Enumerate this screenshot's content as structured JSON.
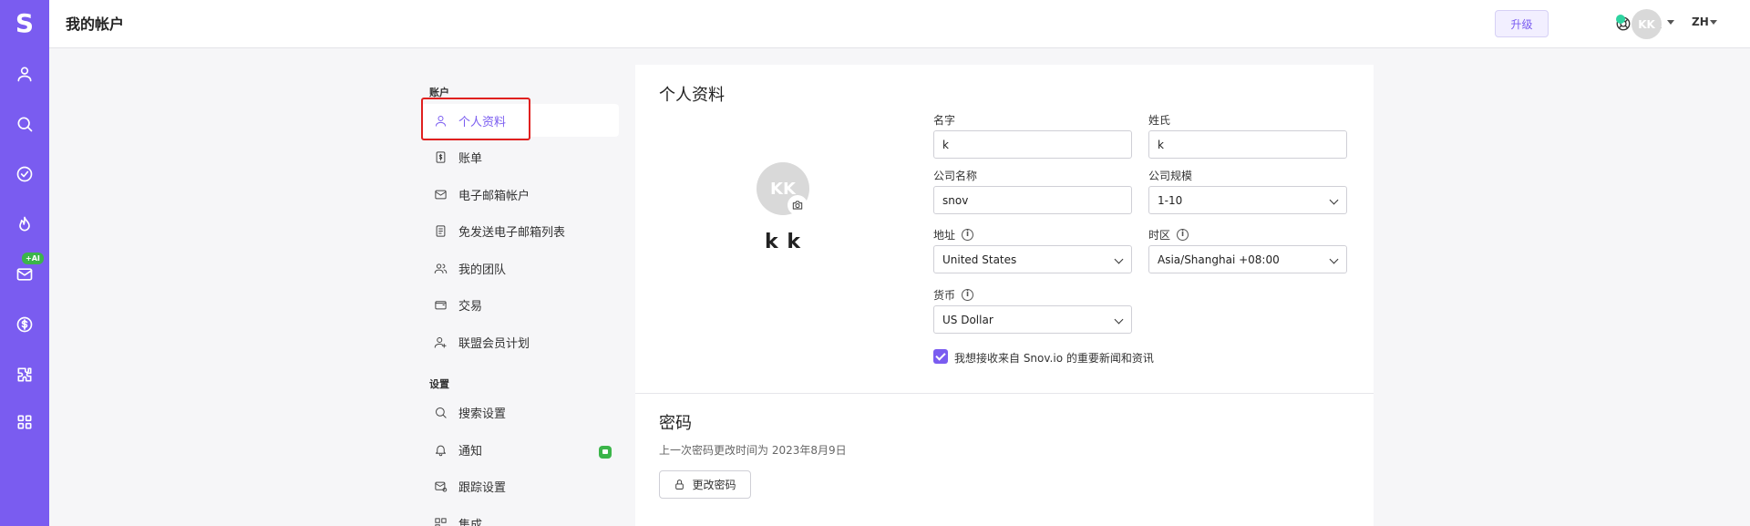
{
  "rail": {
    "logo": "S",
    "ai_badge": "+AI",
    "icons": [
      "user-icon",
      "search-icon",
      "check-circle-icon",
      "flame-icon",
      "mail-icon",
      "dollar-icon",
      "puzzle-icon",
      "apps-grid-icon"
    ]
  },
  "header": {
    "title": "我的帐户",
    "upgrade_label": "升级",
    "avatar_initials": "KK",
    "language": "ZH"
  },
  "nav": {
    "account_section": "账户",
    "account_items": [
      {
        "label": "个人资料",
        "icon": "user-icon",
        "active": true
      },
      {
        "label": "账单",
        "icon": "dollar-doc-icon"
      },
      {
        "label": "电子邮箱帐户",
        "icon": "mail-icon"
      },
      {
        "label": "免发送电子邮箱列表",
        "icon": "document-icon"
      },
      {
        "label": "我的团队",
        "icon": "team-icon"
      },
      {
        "label": "交易",
        "icon": "wallet-icon"
      },
      {
        "label": "联盟会员计划",
        "icon": "user-plus-icon"
      }
    ],
    "settings_section": "设置",
    "settings_items": [
      {
        "label": "搜索设置",
        "icon": "search-icon"
      },
      {
        "label": "通知",
        "icon": "bell-icon"
      },
      {
        "label": "跟踪设置",
        "icon": "mail-gear-icon"
      },
      {
        "label": "集成",
        "icon": "integration-icon"
      }
    ]
  },
  "profile": {
    "title": "个人资料",
    "avatar_initials": "KK",
    "display_name": "k k",
    "first_name_label": "名字",
    "first_name": "k",
    "last_name_label": "姓氏",
    "last_name": "k",
    "company_label": "公司名称",
    "company": "snov",
    "company_size_label": "公司规模",
    "company_size": "1-10",
    "address_label": "地址",
    "address": "United States",
    "timezone_label": "时区",
    "timezone": "Asia/Shanghai +08:00",
    "currency_label": "货币",
    "currency": "US Dollar",
    "newsletter_label": "我想接收来自 Snov.io 的重要新闻和资讯",
    "newsletter_checked": true
  },
  "password": {
    "title": "密码",
    "last_changed": "上一次密码更改时间为 2023年8月9日",
    "change_label": "更改密码"
  },
  "colors": {
    "brand": "#7a5cf0",
    "highlight": "#e0201f",
    "success": "#3bb54a"
  }
}
